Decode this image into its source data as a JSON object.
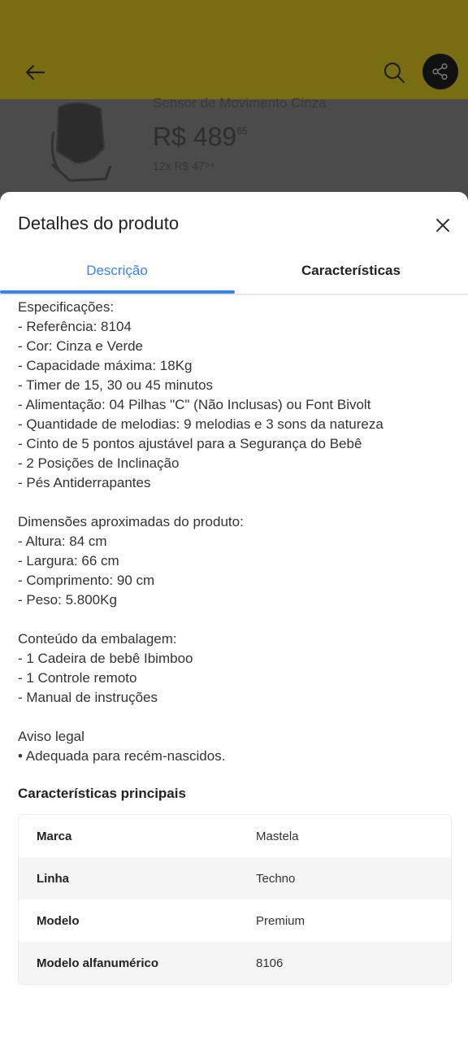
{
  "header": {
    "back_icon": "arrow-left-icon",
    "search_icon": "search-icon",
    "share_icon": "share-icon"
  },
  "product": {
    "title": "Sensor de Movimento Cinza",
    "price_main": "R$ 489",
    "price_cents": "65",
    "installments": "12x R$ 47⁹⁴"
  },
  "sheet": {
    "title": "Detalhes do produto",
    "tabs": [
      {
        "label": "Descrição",
        "active": true
      },
      {
        "label": "Características",
        "active": false
      }
    ],
    "description": [
      "Especificações:",
      "- Referência: 8104",
      "- Cor: Cinza e Verde",
      "- Capacidade máxima: 18Kg",
      "- Timer de 15, 30 ou 45 minutos",
      "- Alimentação: 04 Pilhas \"C\" (Não Inclusas) ou Font Bivolt",
      "- Quantidade de melodias: 9 melodias e 3 sons da natureza",
      "- Cinto de 5 pontos ajustável para a Segurança do Bebê",
      "- 2 Posições de Inclinação",
      "- Pés Antiderrapantes",
      "",
      "Dimensões aproximadas do produto:",
      "- Altura: 84 cm",
      "- Largura: 66 cm",
      "- Comprimento: 90 cm",
      "- Peso: 5.800Kg",
      "",
      "Conteúdo da embalagem:",
      "- 1 Cadeira de bebê Ibimboo",
      "- 1 Controle remoto",
      "- Manual de instruções",
      "",
      "Aviso legal",
      "• Adequada para recém-nascidos."
    ],
    "specs_title": "Características principais",
    "specs": [
      {
        "key": "Marca",
        "value": "Mastela"
      },
      {
        "key": "Linha",
        "value": "Techno"
      },
      {
        "key": "Modelo",
        "value": "Premium"
      },
      {
        "key": "Modelo alfanumérico",
        "value": "8106"
      }
    ]
  },
  "colors": {
    "accent": "#3483fa",
    "header_dimmed": "#796d14"
  }
}
